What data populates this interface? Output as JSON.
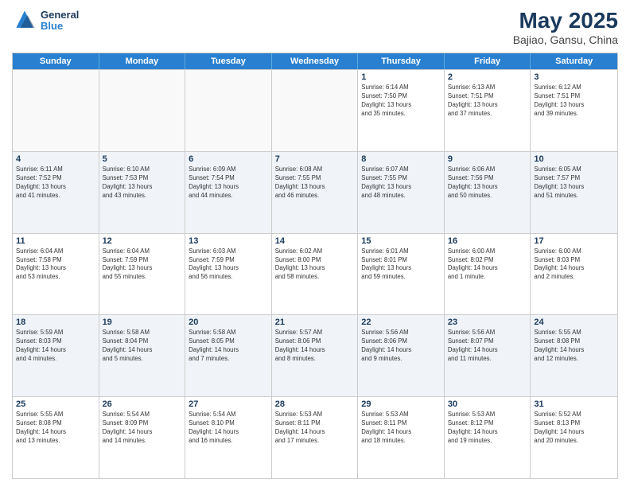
{
  "header": {
    "logo_line1": "General",
    "logo_line2": "Blue",
    "title": "May 2025",
    "subtitle": "Bajiao, Gansu, China"
  },
  "days_of_week": [
    "Sunday",
    "Monday",
    "Tuesday",
    "Wednesday",
    "Thursday",
    "Friday",
    "Saturday"
  ],
  "weeks": [
    [
      {
        "day": "",
        "info": ""
      },
      {
        "day": "",
        "info": ""
      },
      {
        "day": "",
        "info": ""
      },
      {
        "day": "",
        "info": ""
      },
      {
        "day": "1",
        "info": "Sunrise: 6:14 AM\nSunset: 7:50 PM\nDaylight: 13 hours\nand 35 minutes."
      },
      {
        "day": "2",
        "info": "Sunrise: 6:13 AM\nSunset: 7:51 PM\nDaylight: 13 hours\nand 37 minutes."
      },
      {
        "day": "3",
        "info": "Sunrise: 6:12 AM\nSunset: 7:51 PM\nDaylight: 13 hours\nand 39 minutes."
      }
    ],
    [
      {
        "day": "4",
        "info": "Sunrise: 6:11 AM\nSunset: 7:52 PM\nDaylight: 13 hours\nand 41 minutes."
      },
      {
        "day": "5",
        "info": "Sunrise: 6:10 AM\nSunset: 7:53 PM\nDaylight: 13 hours\nand 43 minutes."
      },
      {
        "day": "6",
        "info": "Sunrise: 6:09 AM\nSunset: 7:54 PM\nDaylight: 13 hours\nand 44 minutes."
      },
      {
        "day": "7",
        "info": "Sunrise: 6:08 AM\nSunset: 7:55 PM\nDaylight: 13 hours\nand 46 minutes."
      },
      {
        "day": "8",
        "info": "Sunrise: 6:07 AM\nSunset: 7:55 PM\nDaylight: 13 hours\nand 48 minutes."
      },
      {
        "day": "9",
        "info": "Sunrise: 6:06 AM\nSunset: 7:56 PM\nDaylight: 13 hours\nand 50 minutes."
      },
      {
        "day": "10",
        "info": "Sunrise: 6:05 AM\nSunset: 7:57 PM\nDaylight: 13 hours\nand 51 minutes."
      }
    ],
    [
      {
        "day": "11",
        "info": "Sunrise: 6:04 AM\nSunset: 7:58 PM\nDaylight: 13 hours\nand 53 minutes."
      },
      {
        "day": "12",
        "info": "Sunrise: 6:04 AM\nSunset: 7:59 PM\nDaylight: 13 hours\nand 55 minutes."
      },
      {
        "day": "13",
        "info": "Sunrise: 6:03 AM\nSunset: 7:59 PM\nDaylight: 13 hours\nand 56 minutes."
      },
      {
        "day": "14",
        "info": "Sunrise: 6:02 AM\nSunset: 8:00 PM\nDaylight: 13 hours\nand 58 minutes."
      },
      {
        "day": "15",
        "info": "Sunrise: 6:01 AM\nSunset: 8:01 PM\nDaylight: 13 hours\nand 59 minutes."
      },
      {
        "day": "16",
        "info": "Sunrise: 6:00 AM\nSunset: 8:02 PM\nDaylight: 14 hours\nand 1 minute."
      },
      {
        "day": "17",
        "info": "Sunrise: 6:00 AM\nSunset: 8:03 PM\nDaylight: 14 hours\nand 2 minutes."
      }
    ],
    [
      {
        "day": "18",
        "info": "Sunrise: 5:59 AM\nSunset: 8:03 PM\nDaylight: 14 hours\nand 4 minutes."
      },
      {
        "day": "19",
        "info": "Sunrise: 5:58 AM\nSunset: 8:04 PM\nDaylight: 14 hours\nand 5 minutes."
      },
      {
        "day": "20",
        "info": "Sunrise: 5:58 AM\nSunset: 8:05 PM\nDaylight: 14 hours\nand 7 minutes."
      },
      {
        "day": "21",
        "info": "Sunrise: 5:57 AM\nSunset: 8:06 PM\nDaylight: 14 hours\nand 8 minutes."
      },
      {
        "day": "22",
        "info": "Sunrise: 5:56 AM\nSunset: 8:06 PM\nDaylight: 14 hours\nand 9 minutes."
      },
      {
        "day": "23",
        "info": "Sunrise: 5:56 AM\nSunset: 8:07 PM\nDaylight: 14 hours\nand 11 minutes."
      },
      {
        "day": "24",
        "info": "Sunrise: 5:55 AM\nSunset: 8:08 PM\nDaylight: 14 hours\nand 12 minutes."
      }
    ],
    [
      {
        "day": "25",
        "info": "Sunrise: 5:55 AM\nSunset: 8:08 PM\nDaylight: 14 hours\nand 13 minutes."
      },
      {
        "day": "26",
        "info": "Sunrise: 5:54 AM\nSunset: 8:09 PM\nDaylight: 14 hours\nand 14 minutes."
      },
      {
        "day": "27",
        "info": "Sunrise: 5:54 AM\nSunset: 8:10 PM\nDaylight: 14 hours\nand 16 minutes."
      },
      {
        "day": "28",
        "info": "Sunrise: 5:53 AM\nSunset: 8:11 PM\nDaylight: 14 hours\nand 17 minutes."
      },
      {
        "day": "29",
        "info": "Sunrise: 5:53 AM\nSunset: 8:11 PM\nDaylight: 14 hours\nand 18 minutes."
      },
      {
        "day": "30",
        "info": "Sunrise: 5:53 AM\nSunset: 8:12 PM\nDaylight: 14 hours\nand 19 minutes."
      },
      {
        "day": "31",
        "info": "Sunrise: 5:52 AM\nSunset: 8:13 PM\nDaylight: 14 hours\nand 20 minutes."
      }
    ]
  ]
}
